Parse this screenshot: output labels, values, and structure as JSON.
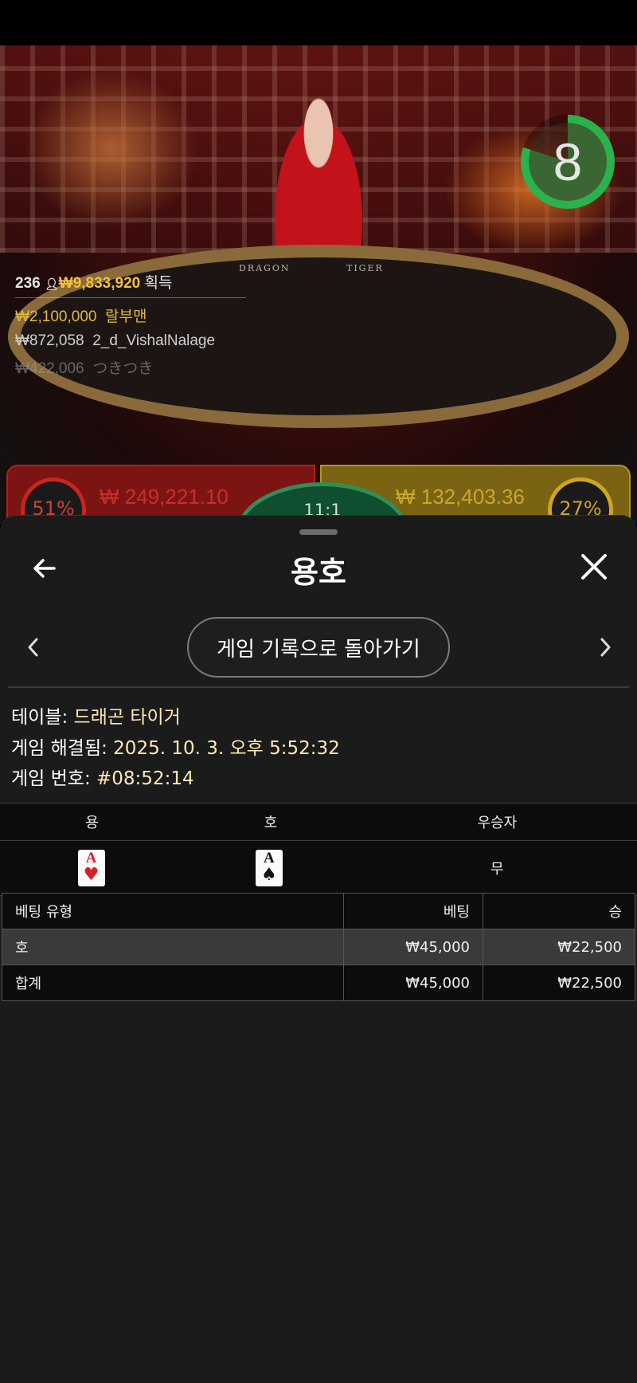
{
  "stream": {
    "timer": "8",
    "table_text_left": "DRAGON",
    "table_text_right": "TIGER",
    "winners": {
      "count": "236",
      "total": "₩9,833,920",
      "total_label": "획득",
      "rows": [
        {
          "amount": "₩2,100,000",
          "name": "랄부맨"
        },
        {
          "amount": "₩872,058",
          "name": "2_d_VishalNalage"
        },
        {
          "amount": "₩422,006",
          "name": "つきつき"
        }
      ]
    },
    "dragon_panel": {
      "percent": "51%",
      "amount": "₩ 249,221.10"
    },
    "tiger_panel": {
      "percent": "27%",
      "amount": "₩ 132,403.36"
    },
    "tie_payout": "11:1"
  },
  "sheet": {
    "title": "용호",
    "history_button": "게임 기록으로 돌아가기",
    "info": [
      {
        "label": "테이블: ",
        "value": "드래곤 타이거"
      },
      {
        "label": "게임 해결됨: ",
        "value": "2025. 10. 3. 오후 5:52:32"
      },
      {
        "label": "게임 번호: ",
        "value": "#08:52:14"
      }
    ],
    "result_headers": [
      "용",
      "호",
      "우승자"
    ],
    "dragon_card": {
      "rank": "A",
      "suit": "♥",
      "color": "#d61f2b"
    },
    "tiger_card": {
      "rank": "A",
      "suit": "♠",
      "color": "#111111"
    },
    "winner": "무",
    "bet_headers": [
      "베팅 유형",
      "베팅",
      "승"
    ],
    "bets": [
      {
        "type": "호",
        "bet": "₩45,000",
        "win": "₩22,500"
      }
    ],
    "total": {
      "type": "합계",
      "bet": "₩45,000",
      "win": "₩22,500"
    }
  }
}
